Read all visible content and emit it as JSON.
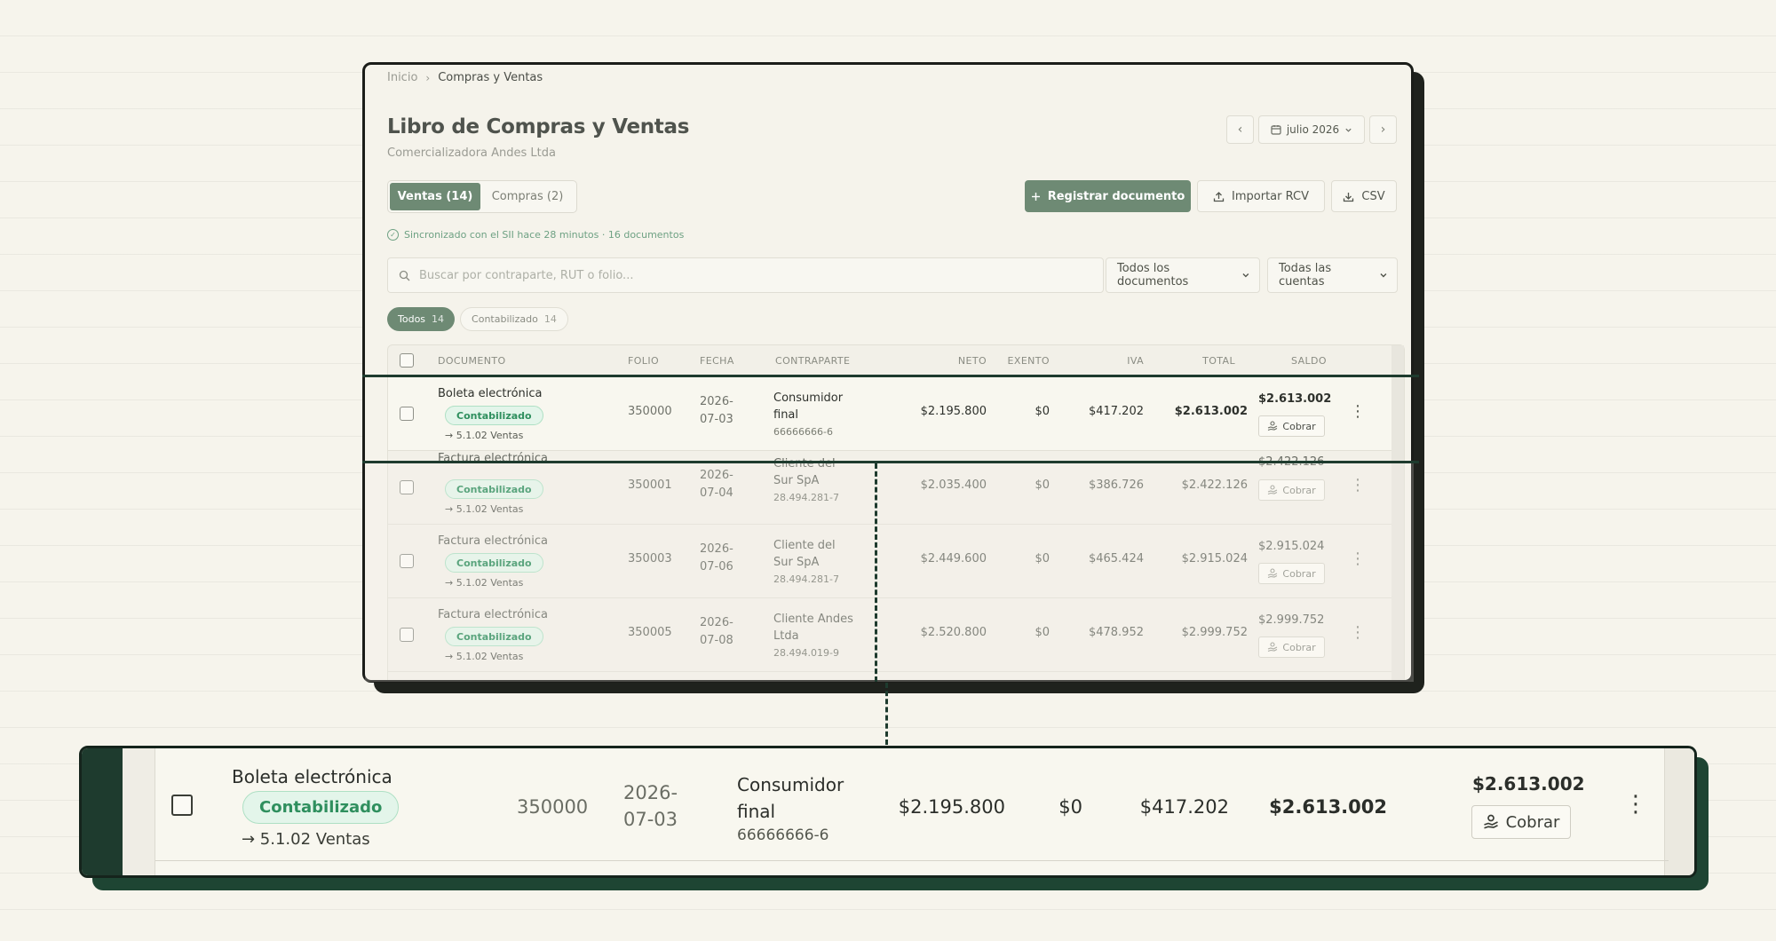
{
  "breadcrumb": {
    "home": "Inicio",
    "separator": "›",
    "current": "Compras y Ventas"
  },
  "page": {
    "title": "Libro de Compras y Ventas",
    "subtitle": "Comercializadora Andes Ltda"
  },
  "period": {
    "prev": "‹",
    "label": "julio 2026",
    "next": "›"
  },
  "tabs": [
    {
      "label": "Ventas (14)",
      "active": true
    },
    {
      "label": "Compras (2)",
      "active": false
    }
  ],
  "actions": {
    "register": "Registrar documento",
    "import": "Importar RCV",
    "csv": "CSV"
  },
  "sync_text": "Sincronizado con el SII hace 28 minutos · 16 documentos",
  "search": {
    "placeholder": "Buscar por contraparte, RUT o folio..."
  },
  "filters": {
    "documents": "Todos los documentos",
    "accounts": "Todas las cuentas"
  },
  "chips": [
    {
      "label": "Todos",
      "count": "14",
      "active": true
    },
    {
      "label": "Contabilizado",
      "count": "14",
      "active": false
    }
  ],
  "columns": {
    "documento": "DOCUMENTO",
    "folio": "FOLIO",
    "fecha": "FECHA",
    "contraparte": "CONTRAPARTE",
    "neto": "NETO",
    "exento": "EXENTO",
    "iva": "IVA",
    "total": "TOTAL",
    "saldo": "SALDO"
  },
  "rows": [
    {
      "type": "Boleta electrónica",
      "status": "Contabilizado",
      "account": "→ 5.1.02 Ventas",
      "folio": "350000",
      "date_line1": "2026-",
      "date_line2": "07-03",
      "cp_name": "Consumidor final",
      "cp_rut": "66666666-6",
      "neto": "$2.195.800",
      "exento": "$0",
      "iva": "$417.202",
      "total": "$2.613.002",
      "saldo": "$2.613.002",
      "action": "Cobrar"
    },
    {
      "type": "Factura electrónica",
      "status": "Contabilizado",
      "account": "→ 5.1.02 Ventas",
      "folio": "350001",
      "date_line1": "2026-",
      "date_line2": "07-04",
      "cp_name": "Cliente del Sur SpA",
      "cp_rut": "28.494.281-7",
      "neto": "$2.035.400",
      "exento": "$0",
      "iva": "$386.726",
      "total": "$2.422.126",
      "saldo": "$2.422.126",
      "action": "Cobrar"
    },
    {
      "type": "Factura electrónica",
      "status": "Contabilizado",
      "account": "→ 5.1.02 Ventas",
      "folio": "350003",
      "date_line1": "2026-",
      "date_line2": "07-06",
      "cp_name": "Cliente del Sur SpA",
      "cp_rut": "28.494.281-7",
      "neto": "$2.449.600",
      "exento": "$0",
      "iva": "$465.424",
      "total": "$2.915.024",
      "saldo": "$2.915.024",
      "action": "Cobrar"
    },
    {
      "type": "Factura electrónica",
      "status": "Contabilizado",
      "account": "→ 5.1.02 Ventas",
      "folio": "350005",
      "date_line1": "2026-",
      "date_line2": "07-08",
      "cp_name": "Cliente Andes Ltda",
      "cp_rut": "28.494.019-9",
      "neto": "$2.520.800",
      "exento": "$0",
      "iva": "$478.952",
      "total": "$2.999.752",
      "saldo": "$2.999.752",
      "action": "Cobrar"
    }
  ],
  "icons": {
    "calendar": "calendar-icon",
    "plus": "plus-icon",
    "upload": "upload-icon",
    "download": "download-icon",
    "check_circle": "check-circle-icon",
    "search": "search-icon",
    "chevron_down": "chevron-down-icon",
    "hand_coins": "hand-coins-icon",
    "kebab": "more-vertical-icon"
  },
  "colors": {
    "primary": "#6e8a74",
    "success_text": "#2f8f5e",
    "success_bg": "#e3f5ea",
    "highlight": "#1e3b2e",
    "background": "#f6f4ec"
  }
}
